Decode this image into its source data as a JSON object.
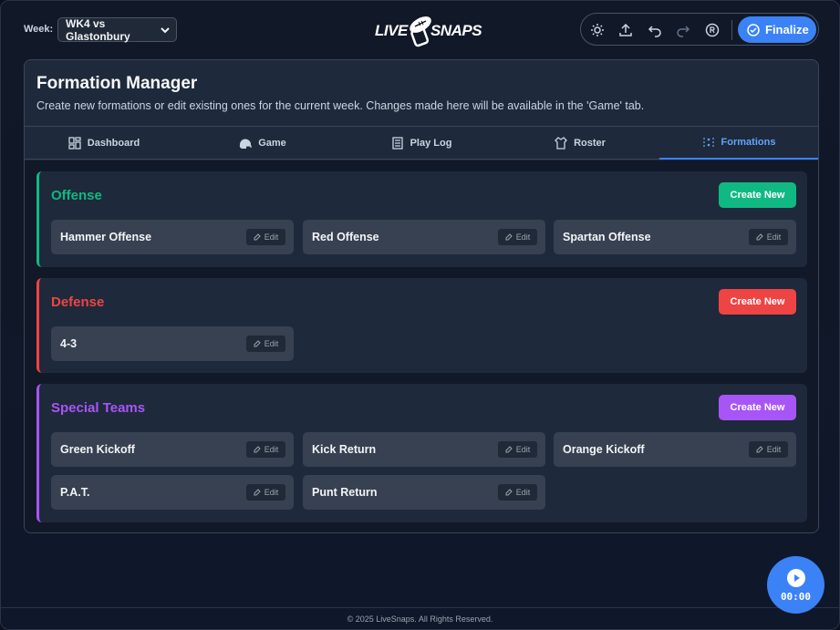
{
  "header": {
    "week_label": "Week:",
    "week_value": "WK4 vs Glastonbury",
    "logo_left": "LIVE",
    "logo_right": "SNAPS",
    "toolbar": {
      "icons": [
        "sun-icon",
        "upload-icon",
        "undo-icon",
        "redo-icon",
        "registered-icon"
      ],
      "finalize_label": "Finalize"
    }
  },
  "panel": {
    "title": "Formation Manager",
    "subtitle": "Create new formations or edit existing ones for the current week. Changes made here will be available in the 'Game' tab."
  },
  "tabs": [
    {
      "label": "Dashboard",
      "icon": "dashboard-icon",
      "active": false
    },
    {
      "label": "Game",
      "icon": "helmet-icon",
      "active": false
    },
    {
      "label": "Play Log",
      "icon": "list-icon",
      "active": false
    },
    {
      "label": "Roster",
      "icon": "jersey-icon",
      "active": false
    },
    {
      "label": "Formations",
      "icon": "formation-icon",
      "active": true
    }
  ],
  "sections": {
    "offense": {
      "title": "Offense",
      "color": "#10b981",
      "create_label": "Create New",
      "cards": [
        "Hammer Offense",
        "Red Offense",
        "Spartan Offense"
      ]
    },
    "defense": {
      "title": "Defense",
      "color": "#ef4444",
      "create_label": "Create New",
      "cards": [
        "4-3"
      ]
    },
    "special": {
      "title": "Special Teams",
      "color": "#a855f7",
      "create_label": "Create New",
      "cards": [
        "Green Kickoff",
        "Kick Return",
        "Orange Kickoff",
        "P.A.T.",
        "Punt Return"
      ]
    }
  },
  "edit_label": "Edit",
  "footer": "© 2025 LiveSnaps. All Rights Reserved.",
  "timer": "00:00"
}
